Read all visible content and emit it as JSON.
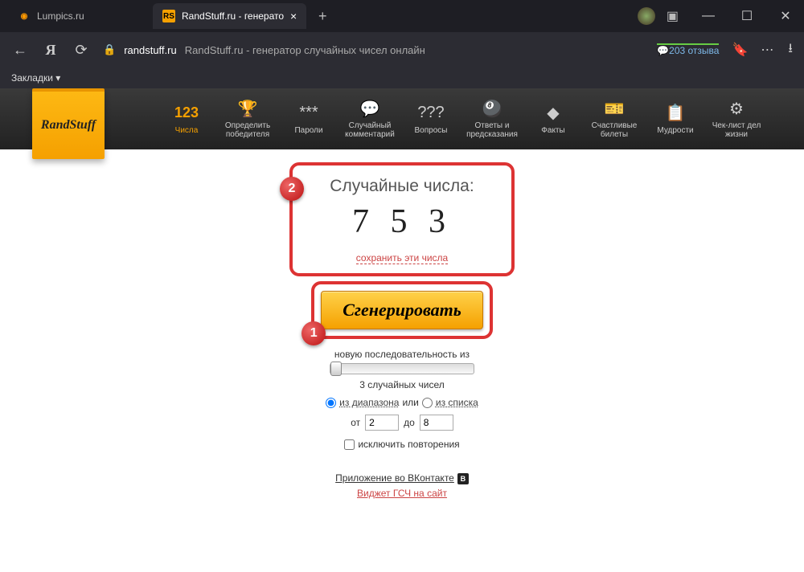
{
  "browser": {
    "tabs": [
      {
        "label": "Lumpics.ru",
        "icon": "◉",
        "active": false
      },
      {
        "label": "RandStuff.ru - генерато",
        "icon": "RS",
        "active": true
      }
    ],
    "url_domain": "randstuff.ru",
    "page_title": "RandStuff.ru - генератор случайных чисел онлайн",
    "reviews": "203 отзыва",
    "bookmarks_label": "Закладки ▾"
  },
  "site": {
    "logo": "RandStuff",
    "nav": [
      {
        "icon": "123",
        "label": "Числа"
      },
      {
        "icon": "🏆",
        "label": "Определить победителя"
      },
      {
        "icon": "***",
        "label": "Пароли"
      },
      {
        "icon": "💬",
        "label": "Случайный комментарий"
      },
      {
        "icon": "???",
        "label": "Вопросы"
      },
      {
        "icon": "🎱",
        "label": "Ответы и предсказания"
      },
      {
        "icon": "◆",
        "label": "Факты"
      },
      {
        "icon": "🎫",
        "label": "Счастливые билеты"
      },
      {
        "icon": "📋",
        "label": "Мудрости"
      },
      {
        "icon": "⚙",
        "label": "Чек-лист дел жизни"
      }
    ]
  },
  "result": {
    "title": "Случайные числа:",
    "numbers": "7 5 3",
    "save": "сохранить эти числа"
  },
  "generate": {
    "button": "Сгенерировать",
    "hint": "новую последовательность из",
    "count_label": "3 случайных чисел",
    "opt_range": "из диапазона",
    "opt_or": "или",
    "opt_list": "из списка",
    "from_label": "от",
    "from_value": "2",
    "to_label": "до",
    "to_value": "8",
    "exclude": "исключить повторения"
  },
  "links": {
    "vk": "Приложение во ВКонтакте",
    "vk_badge": "В",
    "widget": "Виджет ГСЧ на сайт"
  },
  "markers": {
    "m1": "1",
    "m2": "2"
  }
}
